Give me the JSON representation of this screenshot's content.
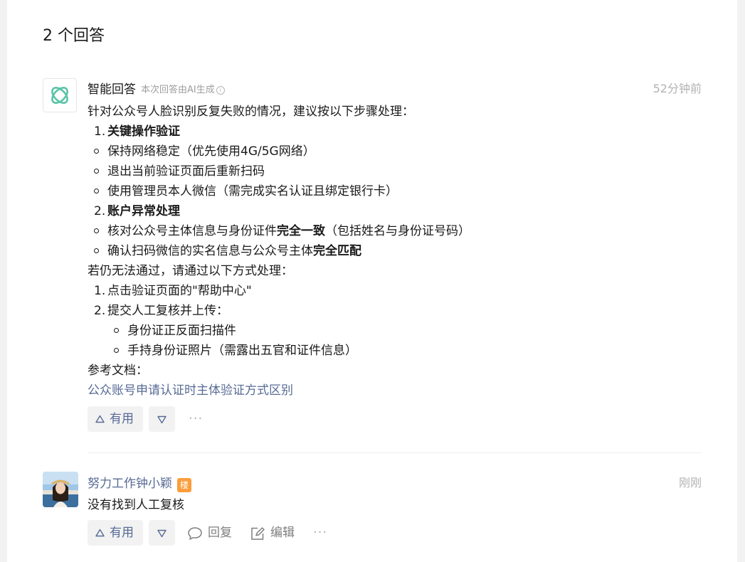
{
  "heading": "2 个回答",
  "ai_answer": {
    "author": "智能回答",
    "note": "本次回答由AI生成",
    "time": "52分钟前",
    "intro": "针对公众号人脸识别反复失败的情况，建议按以下步骤处理：",
    "step1_num": "1.",
    "step1_title": "关键操作验证",
    "step1_items": [
      "保持网络稳定（优先使用4G/5G网络）",
      "退出当前验证页面后重新扫码",
      "使用管理员本人微信（需完成实名认证且绑定银行卡）"
    ],
    "step2_num": "2.",
    "step2_title": "账户异常处理",
    "step2_item1_a": "核对公众号主体信息与身份证件",
    "step2_item1_b": "完全一致",
    "step2_item1_c": "（包括姓名与身份证号码）",
    "step2_item2_a": "确认扫码微信的实名信息与公众号主体",
    "step2_item2_b": "完全匹配",
    "fallback": "若仍无法通过，请通过以下方式处理：",
    "fallback1_num": "1.",
    "fallback1": "点击验证页面的\"帮助中心\"",
    "fallback2_num": "2.",
    "fallback2": "提交人工复核并上传：",
    "fallback2_items": [
      "身份证正反面扫描件",
      "手持身份证照片（需露出五官和证件信息）"
    ],
    "ref_label": "参考文档：",
    "ref_link": "公众账号申请认证时主体验证方式区别",
    "useful": "有用",
    "more": "···"
  },
  "comment": {
    "author": "努力工作钟小颖",
    "badge": "楼",
    "time": "刚刚",
    "text": "没有找到人工复核",
    "useful": "有用",
    "reply": "回复",
    "edit": "编辑",
    "more": "···"
  },
  "colors": {
    "link": "#576b95",
    "badge": "#fa9d3b",
    "muted": "#b2b2b2",
    "ai_logo": "#5ac4a8"
  },
  "icons": {
    "ai_avatar": "ai-logo-icon",
    "info": "info-icon",
    "useful": "triangle-up-icon",
    "not_useful": "triangle-down-icon",
    "reply": "comment-bubble-icon",
    "edit": "edit-pencil-icon"
  }
}
